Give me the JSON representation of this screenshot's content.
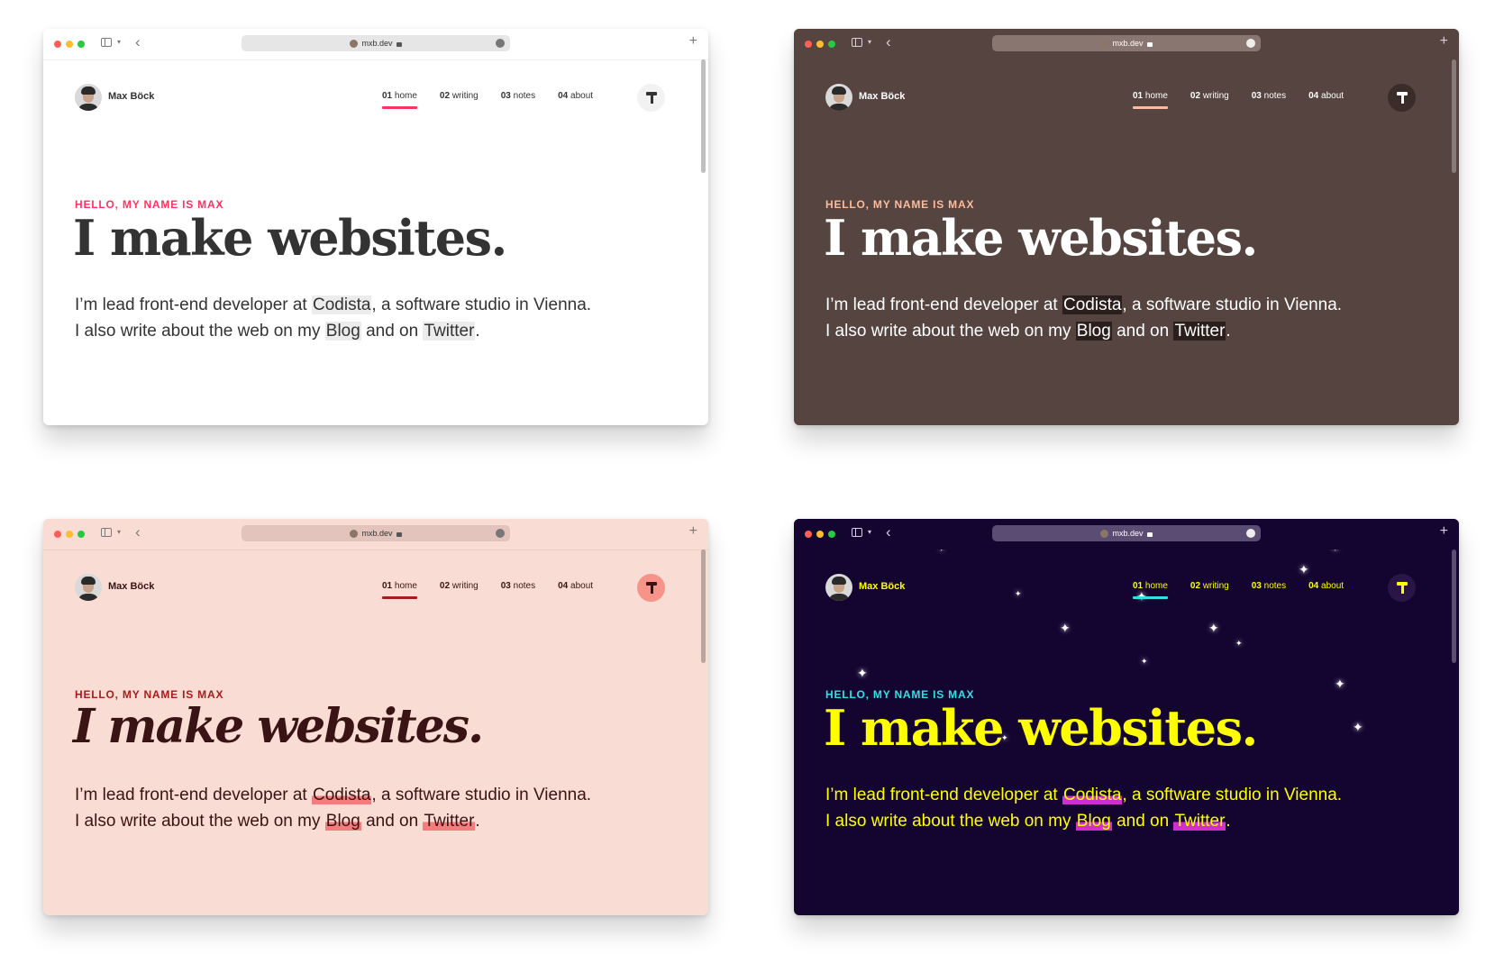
{
  "browser": {
    "url": "mxb.dev",
    "new_tab": "+"
  },
  "site": {
    "name": "Max Böck",
    "nav": [
      {
        "num": "01",
        "label": "home"
      },
      {
        "num": "02",
        "label": "writing"
      },
      {
        "num": "03",
        "label": "notes"
      },
      {
        "num": "04",
        "label": "about"
      }
    ],
    "kicker": "HELLO, MY NAME IS MAX",
    "headline": "I make websites.",
    "intro": {
      "p1_before": "I’m lead front-end developer at ",
      "codista": "Codista",
      "p1_after": ", a software studio in Vienna.",
      "p2_before": "I also write about the web on my ",
      "blog": "Blog",
      "p2_mid": " and on ",
      "twitter": "Twitter",
      "p2_end": "."
    }
  },
  "themes": [
    {
      "name": "default",
      "bg": "#ffffff",
      "chrome": "#ffffff",
      "urlbar": "#e6e6e6",
      "text": "#333333",
      "accent": "#ff335f",
      "link_bg": "#ececec",
      "button_bg": "#f2f2f2",
      "button_fg": "#333333"
    },
    {
      "name": "dark",
      "bg": "#554440",
      "chrome": "#554440",
      "urlbar": "#8a7670",
      "text": "#ffffff",
      "accent": "#fdbb9d",
      "link_bg": "#2a1f1c",
      "button_bg": "#3a2c28",
      "button_fg": "#ffffff"
    },
    {
      "name": "pink",
      "bg": "#f9dcd3",
      "chrome": "#f9dcd3",
      "urlbar": "#e2c4bc",
      "text": "#3a1414",
      "accent": "#a81c1c",
      "link_bg": "#f47c7c",
      "button_bg": "#f7948a",
      "button_fg": "#3a1414"
    },
    {
      "name": "space",
      "bg": "#130430",
      "chrome": "#130430",
      "urlbar": "#5b4c73",
      "text": "#ffff00",
      "accent": "#2de2e6",
      "link_bg": "#d02fd0",
      "button_bg": "#2a1547",
      "button_fg": "#ffff00"
    }
  ],
  "icons": {
    "sidebar": "sidebar-icon",
    "back": "chevron-left-icon",
    "add": "plus-icon",
    "lock": "lock-icon",
    "theme": "paint-roller-icon"
  }
}
